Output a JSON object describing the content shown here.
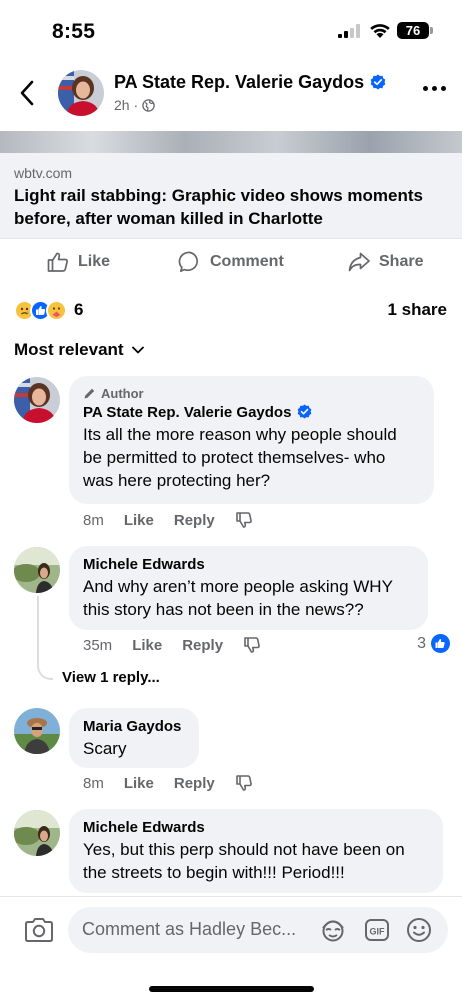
{
  "status": {
    "time": "8:55",
    "battery": "76"
  },
  "header": {
    "name": "PA State Rep. Valerie Gaydos",
    "time": "2h",
    "separator": "·"
  },
  "preview": {
    "domain": "wbtv.com",
    "title": "Light rail stabbing: Graphic video shows moments before, after woman killed in Charlotte"
  },
  "actions": {
    "like": "Like",
    "comment": "Comment",
    "share": "Share"
  },
  "stats": {
    "reaction_count": "6",
    "shares": "1 share"
  },
  "sort": {
    "label": "Most relevant"
  },
  "comments": [
    {
      "author_tag": "Author",
      "name": "PA State Rep. Valerie Gaydos",
      "text": "Its all the more reason why people should be permitted to protect themselves- who was here protecting her?",
      "time": "8m",
      "like": "Like",
      "reply": "Reply"
    },
    {
      "name": "Michele Edwards",
      "text": "And why aren’t more people asking WHY this story has not been in the news??",
      "time": "35m",
      "like": "Like",
      "reply": "Reply",
      "like_count": "3",
      "view_replies": "View 1 reply..."
    },
    {
      "name": "Maria Gaydos",
      "text": "Scary",
      "time": "8m",
      "like": "Like",
      "reply": "Reply"
    },
    {
      "name": "Michele Edwards",
      "text": "Yes, but this perp should not have been on the streets to begin with!!! Period!!!"
    }
  ],
  "composer": {
    "placeholder": "Comment as Hadley Bec..."
  },
  "colors": {
    "accent": "#0866ff",
    "bubble": "#f0f2f5",
    "secondary_text": "#65676b"
  }
}
